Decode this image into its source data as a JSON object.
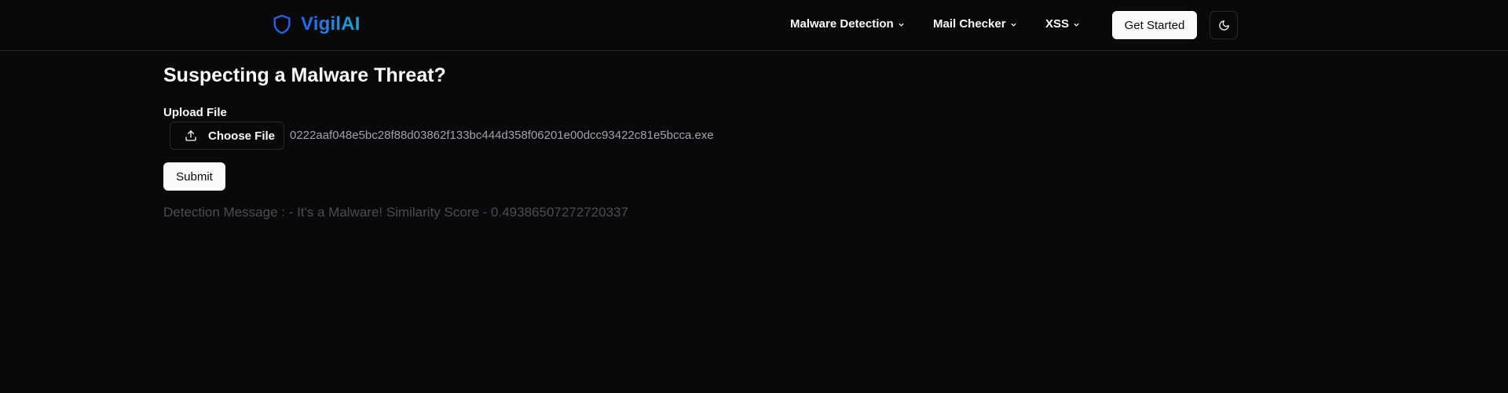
{
  "header": {
    "brand": "VigilAI",
    "brand_icon": "shield-icon",
    "nav": [
      {
        "label": "Malware Detection",
        "icon": "chevron-down-icon"
      },
      {
        "label": "Mail Checker",
        "icon": "chevron-down-icon"
      },
      {
        "label": "XSS",
        "icon": "chevron-down-icon"
      }
    ],
    "cta_label": "Get Started",
    "theme_icon": "moon-icon"
  },
  "main": {
    "title": "Suspecting a Malware Threat?",
    "upload_label": "Upload File",
    "choose_file_label": "Choose File",
    "choose_file_icon": "upload-icon",
    "file_name": "0222aaf048e5bc28f88d03862f133bc444d358f06201e00dcc93422c81e5bcca.exe",
    "submit_label": "Submit",
    "detection_message": "Detection Message : - It's a Malware! Similarity Score - 0.49386507272720337"
  },
  "colors": {
    "background": "#09090b",
    "brand_gradient_start": "#2563eb",
    "brand_gradient_end": "#22a3d6",
    "muted_text": "#a1a1aa"
  }
}
